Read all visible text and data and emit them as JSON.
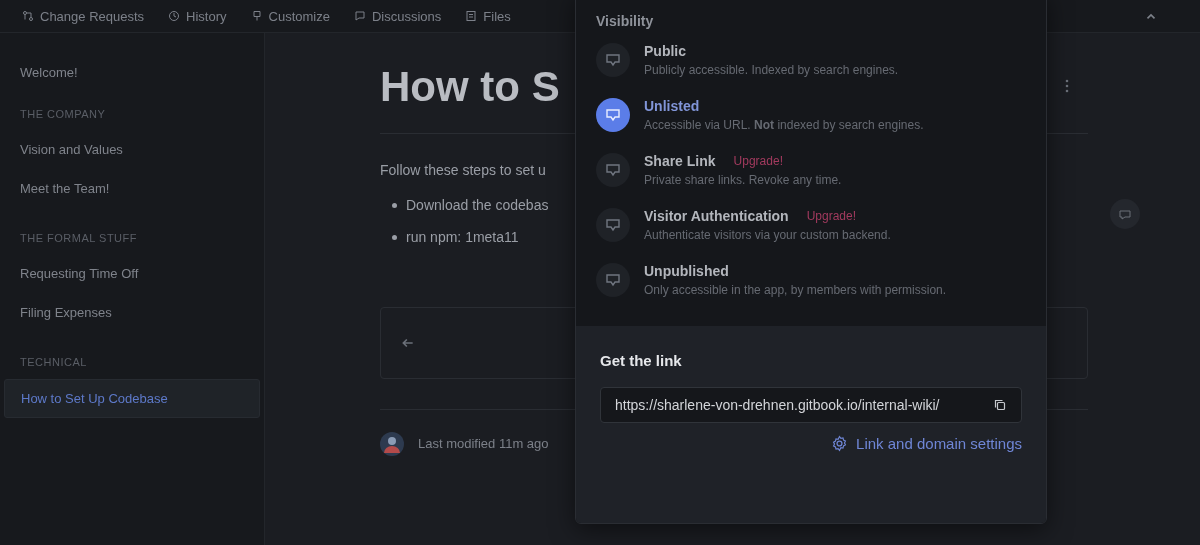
{
  "top_tabs": [
    {
      "label": "Change Requests"
    },
    {
      "label": "History"
    },
    {
      "label": "Customize"
    },
    {
      "label": "Discussions"
    },
    {
      "label": "Files"
    }
  ],
  "sidebar": {
    "items": [
      {
        "kind": "page",
        "label": "Welcome!",
        "selected": false
      },
      {
        "kind": "section",
        "label": "THE COMPANY"
      },
      {
        "kind": "page",
        "label": "Vision and Values",
        "selected": false
      },
      {
        "kind": "page",
        "label": "Meet the Team!",
        "selected": false
      },
      {
        "kind": "section",
        "label": "THE FORMAL STUFF"
      },
      {
        "kind": "page",
        "label": "Requesting Time Off",
        "selected": false
      },
      {
        "kind": "page",
        "label": "Filing Expenses",
        "selected": false
      },
      {
        "kind": "section",
        "label": "TECHNICAL"
      },
      {
        "kind": "page",
        "label": "How to Set Up Codebase",
        "selected": true
      }
    ]
  },
  "page": {
    "title": "How to S",
    "intro": "Follow these steps to set u",
    "bullets": [
      "Download the codebas",
      "run npm: 1meta11"
    ],
    "last_modified": "Last modified 11m ago"
  },
  "visibility_popup": {
    "heading": "Visibility",
    "options": [
      {
        "title": "Public",
        "description": "Publicly accessible. Indexed by search engines.",
        "selected": false
      },
      {
        "title": "Unlisted",
        "description": "Accessible via URL. **Not** indexed by search engines.",
        "selected": true
      },
      {
        "title": "Share Link",
        "badge": "Upgrade!",
        "description": "Private share links. Revoke any time.",
        "selected": false
      },
      {
        "title": "Visitor Authentication",
        "badge": "Upgrade!",
        "description": "Authenticate visitors via your custom backend.",
        "selected": false
      },
      {
        "title": "Unpublished",
        "description": "Only accessible in the app, by members with permission.",
        "selected": false
      }
    ],
    "link_heading": "Get the link",
    "url": "https://sharlene-von-drehnen.gitbook.io/internal-wiki/",
    "settings_link": "Link and domain settings"
  }
}
